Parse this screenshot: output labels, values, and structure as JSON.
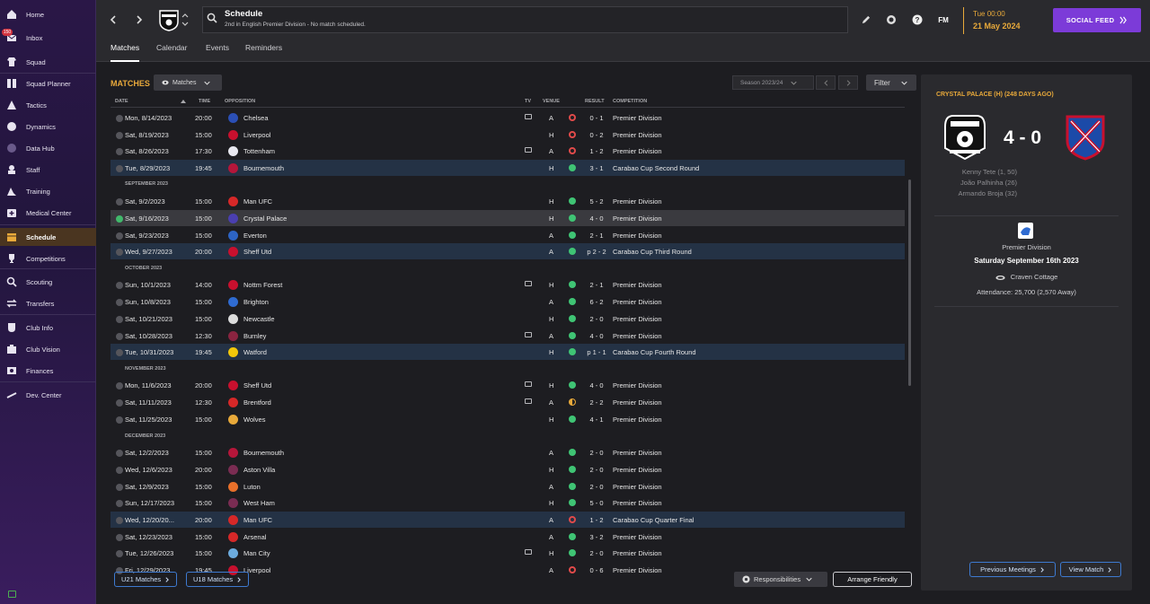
{
  "sidebar": {
    "inbox_badge": "150",
    "items": [
      {
        "label": "Home",
        "icon": "home-icon"
      },
      {
        "label": "Inbox",
        "icon": "inbox-icon"
      },
      {
        "label": "Squad",
        "icon": "shirt-icon"
      },
      {
        "label": "Squad Planner",
        "icon": "squad-planner-icon"
      },
      {
        "label": "Tactics",
        "icon": "tactics-icon"
      },
      {
        "label": "Dynamics",
        "icon": "dynamics-icon"
      },
      {
        "label": "Data Hub",
        "icon": "data-hub-icon"
      },
      {
        "label": "Staff",
        "icon": "staff-icon"
      },
      {
        "label": "Training",
        "icon": "training-icon"
      },
      {
        "label": "Medical Center",
        "icon": "medical-icon"
      },
      {
        "label": "Schedule",
        "icon": "schedule-icon"
      },
      {
        "label": "Competitions",
        "icon": "trophy-icon"
      },
      {
        "label": "Scouting",
        "icon": "scouting-icon"
      },
      {
        "label": "Transfers",
        "icon": "transfers-icon"
      },
      {
        "label": "Club Info",
        "icon": "club-info-icon"
      },
      {
        "label": "Club Vision",
        "icon": "club-vision-icon"
      },
      {
        "label": "Finances",
        "icon": "finances-icon"
      },
      {
        "label": "Dev. Center",
        "icon": "dev-center-icon"
      }
    ]
  },
  "topbar": {
    "title": "Schedule",
    "subtitle": "2nd in English Premier Division - No match scheduled.",
    "fm_label": "FM",
    "time": "Tue 00:00",
    "date": "21 May 2024",
    "social_label": "SOCIAL FEED"
  },
  "tabs": [
    "Matches",
    "Calendar",
    "Events",
    "Reminders"
  ],
  "toolbar": {
    "section_title": "MATCHES",
    "view_dropdown": "Matches",
    "season": "Season 2023/24",
    "filter": "Filter"
  },
  "table": {
    "headers": {
      "date": "DATE",
      "time": "TIME",
      "opposition": "OPPOSITION",
      "tv": "TV",
      "venue": "VENUE",
      "result": "RESULT",
      "competition": "COMPETITION"
    },
    "months": [
      "SEPTEMBER 2023",
      "OCTOBER 2023",
      "NOVEMBER 2023",
      "DECEMBER 2023"
    ],
    "rows": [
      {
        "date": "Mon, 8/14/2023",
        "time": "20:00",
        "opp": "Chelsea",
        "tv": true,
        "venue": "A",
        "result": "0 - 1",
        "outcome": "loss",
        "comp": "Premier Division",
        "crest": "#2b4fb5"
      },
      {
        "date": "Sat, 8/19/2023",
        "time": "15:00",
        "opp": "Liverpool",
        "tv": false,
        "venue": "H",
        "result": "0 - 2",
        "outcome": "loss",
        "comp": "Premier Division",
        "crest": "#c8102e"
      },
      {
        "date": "Sat, 8/26/2023",
        "time": "17:30",
        "opp": "Tottenham",
        "tv": true,
        "venue": "A",
        "result": "1 - 2",
        "outcome": "loss",
        "comp": "Premier Division",
        "crest": "#e8e8f0"
      },
      {
        "date": "Tue, 8/29/2023",
        "time": "19:45",
        "opp": "Bournemouth",
        "tv": false,
        "venue": "H",
        "result": "3 - 1",
        "outcome": "win",
        "comp": "Carabao Cup Second Round",
        "crest": "#b5163a",
        "hl": true
      },
      {
        "date": "Sat, 9/2/2023",
        "time": "15:00",
        "opp": "Man UFC",
        "tv": false,
        "venue": "H",
        "result": "5 - 2",
        "outcome": "win",
        "comp": "Premier Division",
        "crest": "#d62828"
      },
      {
        "date": "Sat, 9/16/2023",
        "time": "15:00",
        "opp": "Crystal Palace",
        "tv": false,
        "venue": "H",
        "result": "4 - 0",
        "outcome": "win",
        "comp": "Premier Division",
        "crest": "#4a3fb0",
        "sel": true
      },
      {
        "date": "Sat, 9/23/2023",
        "time": "15:00",
        "opp": "Everton",
        "tv": false,
        "venue": "A",
        "result": "2 - 1",
        "outcome": "win",
        "comp": "Premier Division",
        "crest": "#2d64c4"
      },
      {
        "date": "Wed, 9/27/2023",
        "time": "20:00",
        "opp": "Sheff Utd",
        "tv": false,
        "venue": "A",
        "result": "p 2 - 2",
        "outcome": "win",
        "comp": "Carabao Cup Third Round",
        "crest": "#c8102e",
        "hl": true
      },
      {
        "date": "Sun, 10/1/2023",
        "time": "14:00",
        "opp": "Nottm Forest",
        "tv": true,
        "venue": "H",
        "result": "2 - 1",
        "outcome": "win",
        "comp": "Premier Division",
        "crest": "#c8102e"
      },
      {
        "date": "Sun, 10/8/2023",
        "time": "15:00",
        "opp": "Brighton",
        "tv": false,
        "venue": "A",
        "result": "6 - 2",
        "outcome": "win",
        "comp": "Premier Division",
        "crest": "#2f6bd1"
      },
      {
        "date": "Sat, 10/21/2023",
        "time": "15:00",
        "opp": "Newcastle",
        "tv": false,
        "venue": "H",
        "result": "2 - 0",
        "outcome": "win",
        "comp": "Premier Division",
        "crest": "#dcdcdc"
      },
      {
        "date": "Sat, 10/28/2023",
        "time": "12:30",
        "opp": "Burnley",
        "tv": true,
        "venue": "A",
        "result": "4 - 0",
        "outcome": "win",
        "comp": "Premier Division",
        "crest": "#8a2440"
      },
      {
        "date": "Tue, 10/31/2023",
        "time": "19:45",
        "opp": "Watford",
        "tv": false,
        "venue": "H",
        "result": "p 1 - 1",
        "outcome": "win",
        "comp": "Carabao Cup Fourth Round",
        "crest": "#f2c70a",
        "hl": true
      },
      {
        "date": "Mon, 11/6/2023",
        "time": "20:00",
        "opp": "Sheff Utd",
        "tv": true,
        "venue": "H",
        "result": "4 - 0",
        "outcome": "win",
        "comp": "Premier Division",
        "crest": "#c8102e"
      },
      {
        "date": "Sat, 11/11/2023",
        "time": "12:30",
        "opp": "Brentford",
        "tv": true,
        "venue": "A",
        "result": "2 - 2",
        "outcome": "draw",
        "comp": "Premier Division",
        "crest": "#d62828"
      },
      {
        "date": "Sat, 11/25/2023",
        "time": "15:00",
        "opp": "Wolves",
        "tv": false,
        "venue": "H",
        "result": "4 - 1",
        "outcome": "win",
        "comp": "Premier Division",
        "crest": "#e8a93a"
      },
      {
        "date": "Sat, 12/2/2023",
        "time": "15:00",
        "opp": "Bournemouth",
        "tv": false,
        "venue": "A",
        "result": "2 - 0",
        "outcome": "win",
        "comp": "Premier Division",
        "crest": "#b5163a"
      },
      {
        "date": "Wed, 12/6/2023",
        "time": "20:00",
        "opp": "Aston Villa",
        "tv": false,
        "venue": "H",
        "result": "2 - 0",
        "outcome": "win",
        "comp": "Premier Division",
        "crest": "#7a2c52"
      },
      {
        "date": "Sat, 12/9/2023",
        "time": "15:00",
        "opp": "Luton",
        "tv": false,
        "venue": "A",
        "result": "2 - 0",
        "outcome": "win",
        "comp": "Premier Division",
        "crest": "#e8702a"
      },
      {
        "date": "Sun, 12/17/2023",
        "time": "15:00",
        "opp": "West Ham",
        "tv": false,
        "venue": "H",
        "result": "5 - 0",
        "outcome": "win",
        "comp": "Premier Division",
        "crest": "#7a2c52"
      },
      {
        "date": "Wed, 12/20/20...",
        "time": "20:00",
        "opp": "Man UFC",
        "tv": false,
        "venue": "A",
        "result": "1 - 2",
        "outcome": "loss",
        "comp": "Carabao Cup Quarter Final",
        "crest": "#d62828",
        "hl": true
      },
      {
        "date": "Sat, 12/23/2023",
        "time": "15:00",
        "opp": "Arsenal",
        "tv": false,
        "venue": "A",
        "result": "3 - 2",
        "outcome": "win",
        "comp": "Premier Division",
        "crest": "#d62828"
      },
      {
        "date": "Tue, 12/26/2023",
        "time": "15:00",
        "opp": "Man City",
        "tv": true,
        "venue": "H",
        "result": "2 - 0",
        "outcome": "win",
        "comp": "Premier Division",
        "crest": "#6cabdd"
      },
      {
        "date": "Fri, 12/29/2023",
        "time": "19:45",
        "opp": "Liverpool",
        "tv": false,
        "venue": "A",
        "result": "0 - 6",
        "outcome": "loss",
        "comp": "Premier Division",
        "crest": "#c8102e"
      }
    ]
  },
  "footer": {
    "u21": "U21 Matches",
    "u18": "U18 Matches",
    "responsibilities": "Responsibilities",
    "arrange": "Arrange Friendly"
  },
  "panel": {
    "title": "CRYSTAL PALACE (H) (248 DAYS AGO)",
    "score": "4 - 0",
    "scorers": [
      "Kenny Tete (1, 50)",
      "João Palhinha (26)",
      "Armando Broja (32)"
    ],
    "competition": "Premier Division",
    "date": "Saturday September 16th 2023",
    "venue": "Craven Cottage",
    "attendance": "Attendance: 25,700 (2,570 Away)",
    "previous": "Previous Meetings",
    "view": "View Match"
  }
}
